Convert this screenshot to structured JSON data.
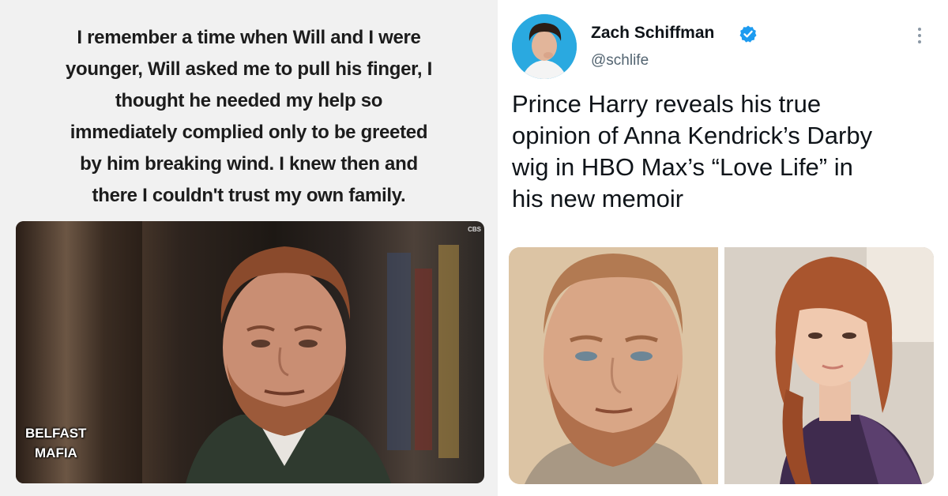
{
  "meme": {
    "caption_lines": [
      "I remember a time when Will and I were",
      "younger, Will asked me to pull his finger, I",
      "thought he needed my help so",
      "immediately complied only to be greeted",
      "by him breaking wind.  I knew then and",
      "there I couldn't trust my own family."
    ],
    "overlay_lines": [
      "BELFAST",
      "MAFIA"
    ],
    "watermark": "CBS"
  },
  "tweet": {
    "author_name": "Zach Schiffman",
    "handle": "@schlife",
    "verified": true,
    "text_lines": [
      "Prince Harry reveals his true",
      "opinion of Anna Kendrick’s Darby",
      "wig in HBO Max’s “Love Life” in",
      "his new memoir"
    ],
    "media_count": 2
  },
  "colors": {
    "verified_blue": "#1d9bf0",
    "avatar_bg": "#2aa9e0",
    "text_primary": "#0f1419",
    "text_secondary": "#536471",
    "meme_bg": "#f1f1f1"
  },
  "icons": [
    "verified-badge-icon",
    "more-options-icon"
  ]
}
